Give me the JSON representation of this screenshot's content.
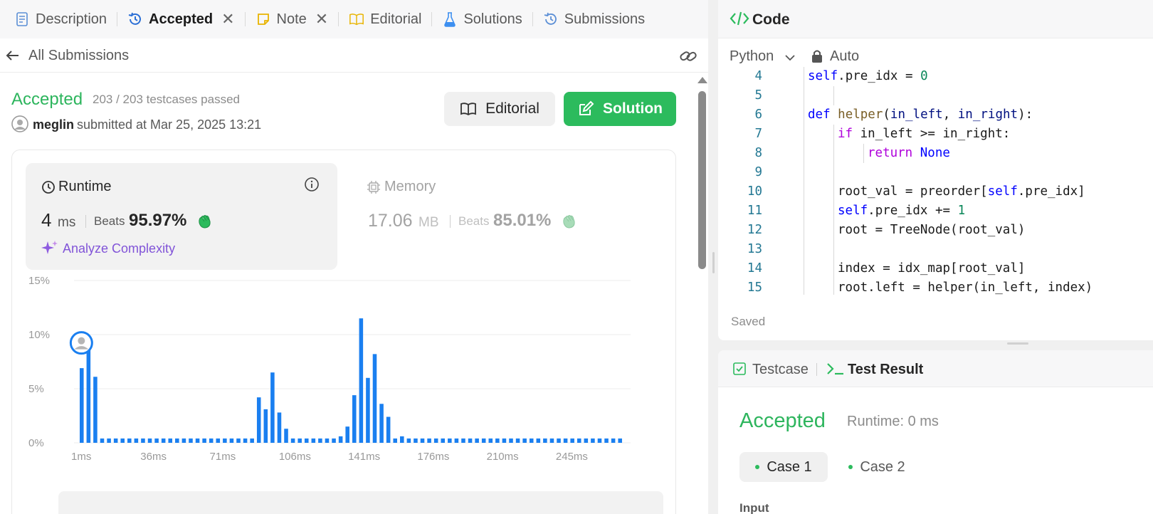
{
  "tabs": [
    {
      "label": "Description",
      "icon": "document-icon",
      "closable": false,
      "active": false
    },
    {
      "label": "Accepted",
      "icon": "history-icon",
      "closable": true,
      "active": true
    },
    {
      "label": "Note",
      "icon": "note-icon",
      "closable": true,
      "active": false
    },
    {
      "label": "Editorial",
      "icon": "book-icon",
      "closable": false,
      "active": false
    },
    {
      "label": "Solutions",
      "icon": "flask-icon",
      "closable": false,
      "active": false
    },
    {
      "label": "Submissions",
      "icon": "history-icon",
      "closable": false,
      "active": false
    }
  ],
  "subbar": {
    "back_label": "All Submissions"
  },
  "submission": {
    "status": "Accepted",
    "testcases": "203 / 203 testcases passed",
    "user": "meglin",
    "submitted_at": "submitted at Mar 25, 2025 13:21",
    "editorial_btn": "Editorial",
    "solution_btn": "Solution"
  },
  "runtime": {
    "label": "Runtime",
    "value": "4",
    "unit": "ms",
    "beats_label": "Beats",
    "beats_value": "95.97%",
    "analyze": "Analyze Complexity"
  },
  "memory": {
    "label": "Memory",
    "value": "17.06",
    "unit": "MB",
    "beats_label": "Beats",
    "beats_value": "85.01%"
  },
  "colors": {
    "accent_green": "#2db55d",
    "bar_blue": "#1a7ff0",
    "analyze_purple": "#8154d8"
  },
  "chart_data": {
    "type": "bar",
    "ylim": [
      0,
      15
    ],
    "yticks": [
      "0%",
      "5%",
      "10%",
      "15%"
    ],
    "xtick_labels": [
      "1ms",
      "36ms",
      "71ms",
      "106ms",
      "141ms",
      "176ms",
      "210ms",
      "245ms"
    ],
    "grid": true,
    "highlight_bar_index": 1,
    "values": [
      6.9,
      9.1,
      6.1,
      0.4,
      0.4,
      0.4,
      0.4,
      0.4,
      0.4,
      0.4,
      0.4,
      0.4,
      0.4,
      0.4,
      0.4,
      0.4,
      0.4,
      0.4,
      0.4,
      0.4,
      0.4,
      0.4,
      0.4,
      0.4,
      0.4,
      0.4,
      4.2,
      3.1,
      6.5,
      2.8,
      1.3,
      0.4,
      0.4,
      0.4,
      0.4,
      0.4,
      0.4,
      0.4,
      0.6,
      1.5,
      4.4,
      11.5,
      6.0,
      8.2,
      3.6,
      2.4,
      0.4,
      0.6,
      0.4,
      0.4,
      0.4,
      0.4,
      0.4,
      0.4,
      0.4,
      0.4,
      0.4,
      0.4,
      0.4,
      0.4,
      0.4,
      0.4,
      0.4,
      0.4,
      0.4,
      0.4,
      0.4,
      0.4,
      0.4,
      0.4,
      0.4,
      0.4,
      0.4,
      0.4,
      0.4,
      0.4,
      0.4,
      0.4,
      0.4,
      0.4
    ]
  },
  "code": {
    "title": "Code",
    "language": "Python",
    "mode": "Auto",
    "saved": "Saved",
    "lines": [
      {
        "n": "4",
        "indent": 2,
        "tokens": [
          [
            "self",
            "kw2"
          ],
          [
            ".pre_idx = ",
            "p"
          ],
          [
            "0",
            "num"
          ]
        ]
      },
      {
        "n": "5",
        "indent": 0,
        "tokens": []
      },
      {
        "n": "6",
        "indent": 2,
        "tokens": [
          [
            "def ",
            "kw"
          ],
          [
            "helper",
            "fn"
          ],
          [
            "(",
            "p"
          ],
          [
            "in_left",
            "param"
          ],
          [
            ", ",
            "p"
          ],
          [
            "in_right",
            "param"
          ],
          [
            "):",
            "p"
          ]
        ]
      },
      {
        "n": "7",
        "indent": 3,
        "tokens": [
          [
            "if ",
            "kwc"
          ],
          [
            "in_left >= in_right:",
            "p"
          ]
        ]
      },
      {
        "n": "8",
        "indent": 4,
        "tokens": [
          [
            "return ",
            "kwc"
          ],
          [
            "None",
            "kw2"
          ]
        ]
      },
      {
        "n": "9",
        "indent": 0,
        "tokens": []
      },
      {
        "n": "10",
        "indent": 3,
        "tokens": [
          [
            "root_val = preorder[",
            "p"
          ],
          [
            "self",
            "kw2"
          ],
          [
            ".pre_idx]",
            "p"
          ]
        ]
      },
      {
        "n": "11",
        "indent": 3,
        "tokens": [
          [
            "self",
            "kw2"
          ],
          [
            ".pre_idx += ",
            "p"
          ],
          [
            "1",
            "num"
          ]
        ]
      },
      {
        "n": "12",
        "indent": 3,
        "tokens": [
          [
            "root = TreeNode(root_val)",
            "p"
          ]
        ]
      },
      {
        "n": "13",
        "indent": 0,
        "tokens": []
      },
      {
        "n": "14",
        "indent": 3,
        "tokens": [
          [
            "index = idx_map[root_val]",
            "p"
          ]
        ]
      },
      {
        "n": "15",
        "indent": 3,
        "tokens": [
          [
            "root.left = helper(in_left, index)",
            "p"
          ]
        ]
      }
    ]
  },
  "test": {
    "testcase_tab": "Testcase",
    "result_tab": "Test Result",
    "status": "Accepted",
    "runtime": "Runtime: 0 ms",
    "cases": [
      "Case 1",
      "Case 2"
    ],
    "input_label": "Input"
  }
}
